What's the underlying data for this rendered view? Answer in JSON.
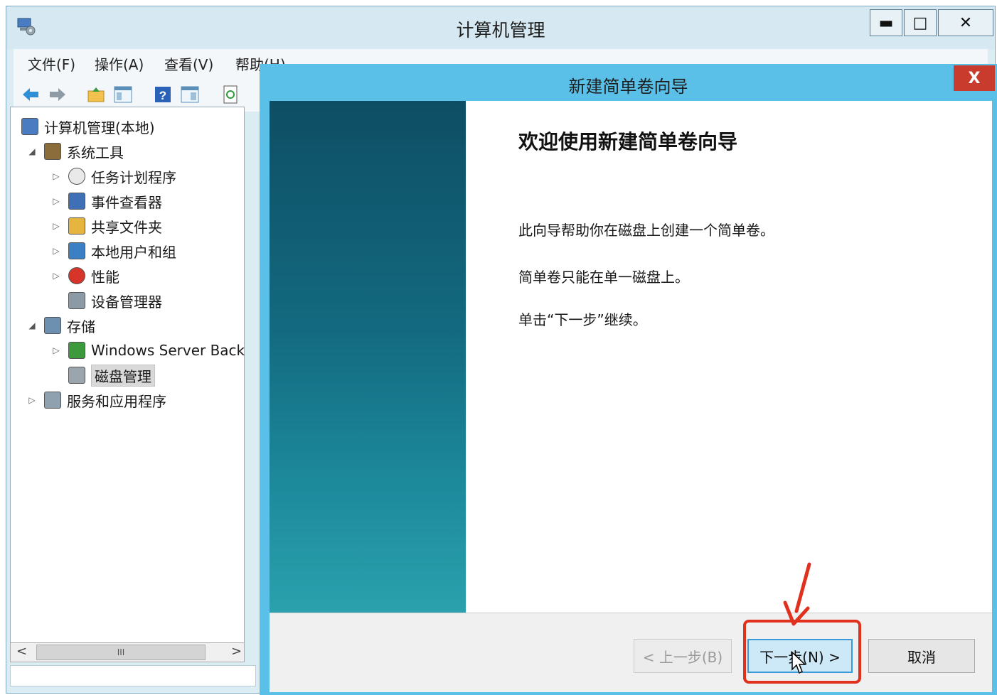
{
  "main_window": {
    "title": "计算机管理",
    "caption_buttons": {
      "minimize": "▬",
      "maximize": "□",
      "close": "✕"
    }
  },
  "menu": [
    "文件(F)",
    "操作(A)",
    "查看(V)",
    "帮助(H)"
  ],
  "toolbar_icons": [
    "back-arrow-icon",
    "forward-arrow-icon",
    "up-folder-icon",
    "show-hide-tree-icon",
    "help-icon",
    "properties-icon",
    "refresh-icon"
  ],
  "tree": [
    {
      "label": "计算机管理(本地)",
      "icon": "computer-management-icon",
      "level": 0,
      "toggle": ""
    },
    {
      "label": "系统工具",
      "icon": "system-tools-icon",
      "level": 1,
      "toggle": "◢"
    },
    {
      "label": "任务计划程序",
      "icon": "task-scheduler-icon",
      "level": 2,
      "toggle": "▷"
    },
    {
      "label": "事件查看器",
      "icon": "event-viewer-icon",
      "level": 2,
      "toggle": "▷"
    },
    {
      "label": "共享文件夹",
      "icon": "shared-folders-icon",
      "level": 2,
      "toggle": "▷"
    },
    {
      "label": "本地用户和组",
      "icon": "local-users-icon",
      "level": 2,
      "toggle": "▷"
    },
    {
      "label": "性能",
      "icon": "performance-icon",
      "level": 2,
      "toggle": "▷"
    },
    {
      "label": "设备管理器",
      "icon": "device-manager-icon",
      "level": 2,
      "toggle": ""
    },
    {
      "label": "存储",
      "icon": "storage-icon",
      "level": 1,
      "toggle": "◢"
    },
    {
      "label": "Windows Server Back",
      "icon": "windows-server-backup-icon",
      "level": 2,
      "toggle": "▷"
    },
    {
      "label": "磁盘管理",
      "icon": "disk-management-icon",
      "level": 2,
      "toggle": "",
      "selected": true
    },
    {
      "label": "服务和应用程序",
      "icon": "services-apps-icon",
      "level": 1,
      "toggle": "▷"
    }
  ],
  "scrollbar": {
    "left": "<",
    "thumb": "III",
    "right": ">"
  },
  "wizard": {
    "title": "新建简单卷向导",
    "close_label": "X",
    "heading": "欢迎使用新建简单卷向导",
    "paragraphs": [
      "此向导帮助你在磁盘上创建一个简单卷。",
      "简单卷只能在单一磁盘上。",
      "单击“下一步”继续。"
    ],
    "buttons": {
      "back": "< 上一步(B)",
      "next": "下一步(N) >",
      "cancel": "取消"
    }
  },
  "colors": {
    "wizard_frame": "#5bc0e8",
    "wizard_close": "#c93c2d",
    "highlight": "#e0301e",
    "banner": "#136a80"
  }
}
